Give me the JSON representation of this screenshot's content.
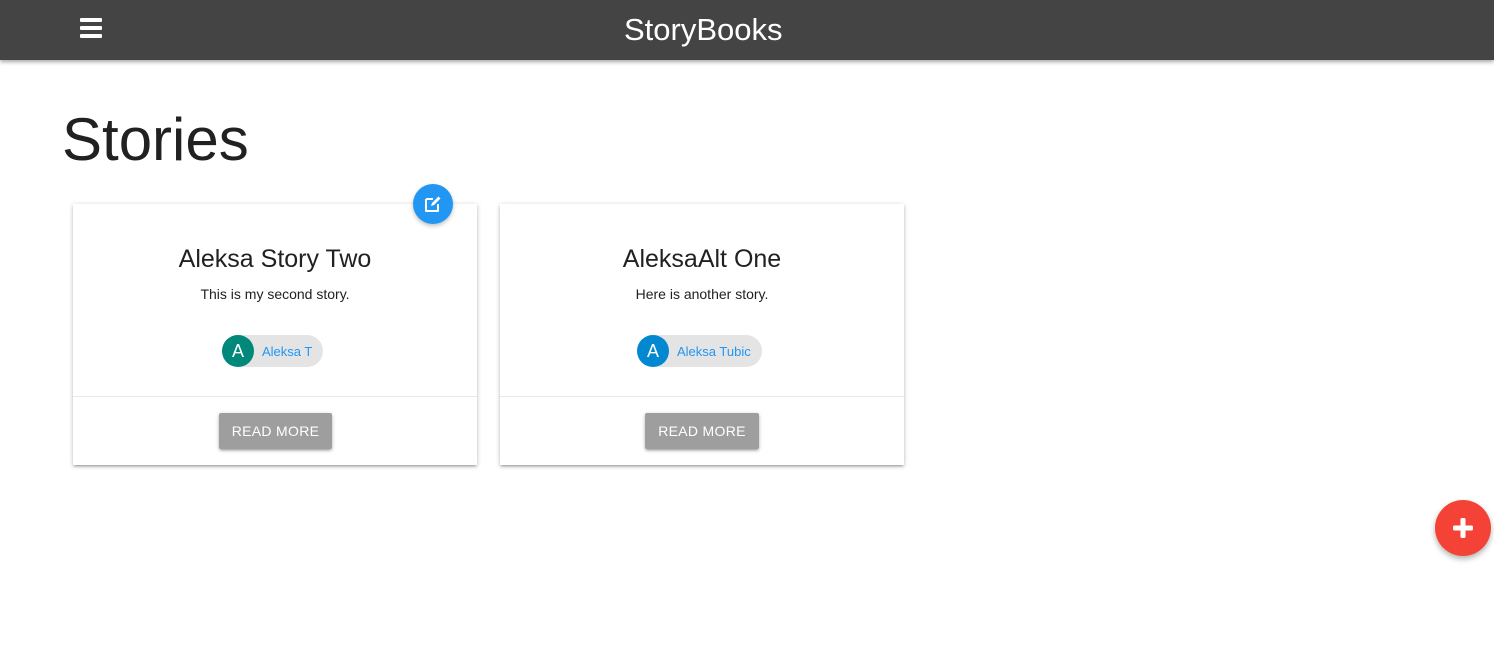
{
  "navbar": {
    "brand": "StoryBooks",
    "menu_icon": "hamburger-menu-icon"
  },
  "page": {
    "title": "Stories"
  },
  "stories": [
    {
      "title": "Aleksa Story Two",
      "body": "This is my second story.",
      "author_initial": "A",
      "author_name": "Aleksa T",
      "avatar_color": "#00897b",
      "action_label": "READ MORE",
      "editable": true
    },
    {
      "title": "AleksaAlt One",
      "body": "Here is another story.",
      "author_initial": "A",
      "author_name": "Aleksa Tubic",
      "avatar_color": "#0288d1",
      "action_label": "READ MORE",
      "editable": false
    }
  ],
  "fabs": {
    "edit_icon": "edit-icon",
    "add_icon": "plus-icon"
  },
  "colors": {
    "navbar": "#444444",
    "link": "#2196f3",
    "edit_fab": "#2196f3",
    "add_fab": "#f44336",
    "button": "#9e9e9e"
  }
}
